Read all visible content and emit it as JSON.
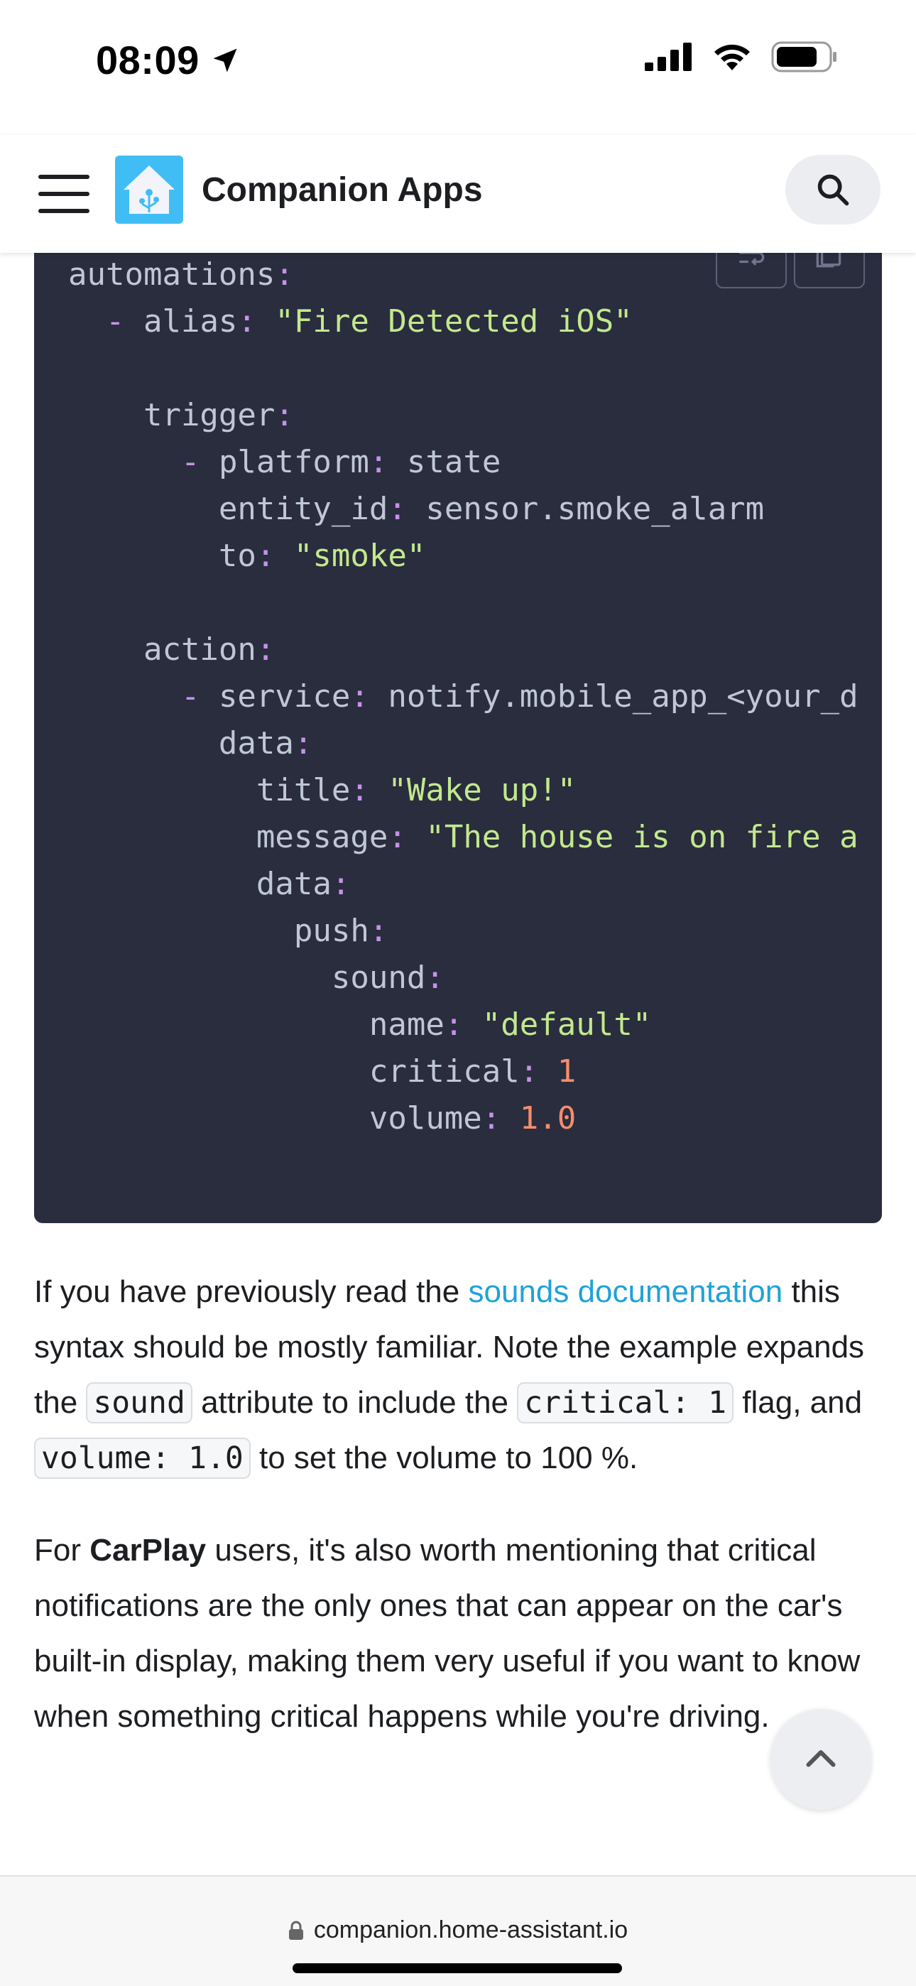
{
  "status_bar": {
    "time": "08:09"
  },
  "navbar": {
    "title": "Companion Apps"
  },
  "code": {
    "lines": [
      [
        {
          "t": "automations",
          "c": "key"
        },
        {
          "t": ":",
          "c": "punc"
        }
      ],
      [
        {
          "t": "  ",
          "c": "key"
        },
        {
          "t": "-",
          "c": "punc"
        },
        {
          "t": " alias",
          "c": "key"
        },
        {
          "t": ":",
          "c": "punc"
        },
        {
          "t": " \"Fire Detected iOS\"",
          "c": "str"
        }
      ],
      [],
      [
        {
          "t": "    trigger",
          "c": "key"
        },
        {
          "t": ":",
          "c": "punc"
        }
      ],
      [
        {
          "t": "      ",
          "c": "key"
        },
        {
          "t": "-",
          "c": "punc"
        },
        {
          "t": " platform",
          "c": "key"
        },
        {
          "t": ":",
          "c": "punc"
        },
        {
          "t": " state",
          "c": "key"
        }
      ],
      [
        {
          "t": "        entity_id",
          "c": "key"
        },
        {
          "t": ":",
          "c": "punc"
        },
        {
          "t": " sensor.smoke_alarm",
          "c": "key"
        }
      ],
      [
        {
          "t": "        to",
          "c": "key"
        },
        {
          "t": ":",
          "c": "punc"
        },
        {
          "t": " \"smoke\"",
          "c": "str"
        }
      ],
      [],
      [
        {
          "t": "    action",
          "c": "key"
        },
        {
          "t": ":",
          "c": "punc"
        }
      ],
      [
        {
          "t": "      ",
          "c": "key"
        },
        {
          "t": "-",
          "c": "punc"
        },
        {
          "t": " service",
          "c": "key"
        },
        {
          "t": ":",
          "c": "punc"
        },
        {
          "t": " notify.mobile_app_<your_d",
          "c": "key"
        }
      ],
      [
        {
          "t": "        data",
          "c": "key"
        },
        {
          "t": ":",
          "c": "punc"
        }
      ],
      [
        {
          "t": "          title",
          "c": "key"
        },
        {
          "t": ":",
          "c": "punc"
        },
        {
          "t": " \"Wake up!\"",
          "c": "str"
        }
      ],
      [
        {
          "t": "          message",
          "c": "key"
        },
        {
          "t": ":",
          "c": "punc"
        },
        {
          "t": " \"The house is on fire a",
          "c": "str"
        }
      ],
      [
        {
          "t": "          data",
          "c": "key"
        },
        {
          "t": ":",
          "c": "punc"
        }
      ],
      [
        {
          "t": "            push",
          "c": "key"
        },
        {
          "t": ":",
          "c": "punc"
        }
      ],
      [
        {
          "t": "              sound",
          "c": "key"
        },
        {
          "t": ":",
          "c": "punc"
        }
      ],
      [
        {
          "t": "                name",
          "c": "key"
        },
        {
          "t": ":",
          "c": "punc"
        },
        {
          "t": " \"default\"",
          "c": "str"
        }
      ],
      [
        {
          "t": "                critical",
          "c": "key"
        },
        {
          "t": ":",
          "c": "punc"
        },
        {
          "t": " 1",
          "c": "num"
        }
      ],
      [
        {
          "t": "                volume",
          "c": "key"
        },
        {
          "t": ":",
          "c": "punc"
        },
        {
          "t": " 1.0",
          "c": "num"
        }
      ]
    ]
  },
  "paragraph1": {
    "before_link": "If you have previously read the ",
    "link": "sounds documentation",
    "after_link": " this syntax should be mostly familiar. Note the example expands the ",
    "code_sound": "sound",
    "after_sound": " attribute to include the ",
    "code_critical": "critical: 1",
    "after_critical": " flag, and ",
    "code_volume": "volume: 1.0",
    "after_volume": " to set the volume to 100 %."
  },
  "paragraph2": {
    "before_bold": "For ",
    "bold": "CarPlay",
    "after_bold": " users, it's also worth mentioning that critical notifications are the only ones that can appear on the car's built-in display, making them very useful if you want to know when something critical happens while you're driving."
  },
  "browser": {
    "url": "companion.home-assistant.io"
  },
  "colors": {
    "code_bg": "#292d3e",
    "code_key": "#bfc7d5",
    "code_punc": "#c792ea",
    "code_string": "#c3e88d",
    "code_number": "#f78c6c",
    "link": "#1fa2d9",
    "logo_bg": "#41bdf5"
  },
  "icons": [
    "location-arrow-icon",
    "cellular-signal-icon",
    "wifi-icon",
    "battery-icon",
    "hamburger-menu-icon",
    "home-assistant-logo",
    "search-icon",
    "wrap-lines-icon",
    "copy-icon",
    "chevron-up-icon",
    "lock-icon"
  ]
}
